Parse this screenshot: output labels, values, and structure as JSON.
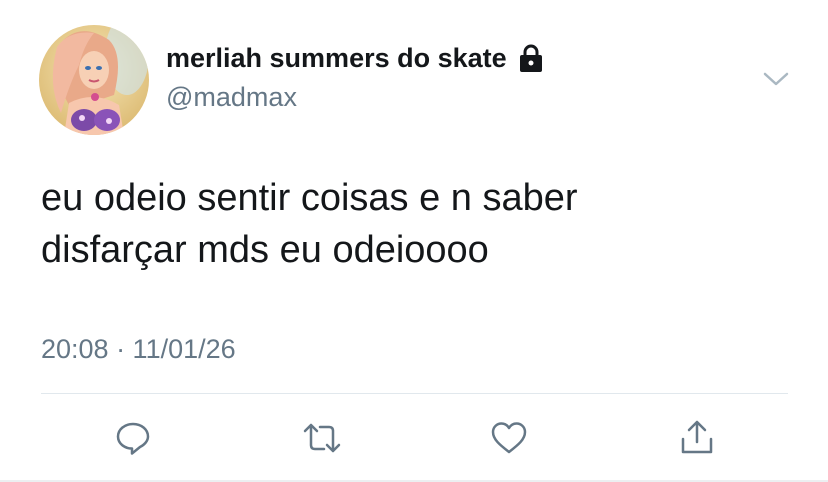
{
  "user": {
    "display_name": "merliah summers do skate",
    "handle": "@madmax",
    "avatar_icon": "profile-avatar",
    "verified_lock_icon": "lock-icon"
  },
  "tweet": {
    "lines": [
      "eu odeio sentir coisas e n saber",
      "disfarçar mds eu odeioooo"
    ],
    "timestamp": "20:08 · 11/01/26"
  },
  "actions": [
    {
      "icon": "reply-icon"
    },
    {
      "icon": "retweet-icon"
    },
    {
      "icon": "like-icon"
    },
    {
      "icon": "share-icon"
    }
  ],
  "colors": {
    "text": "#14171a",
    "secondary": "#657786",
    "icon": "#657786",
    "divider": "#e1e8ed"
  }
}
